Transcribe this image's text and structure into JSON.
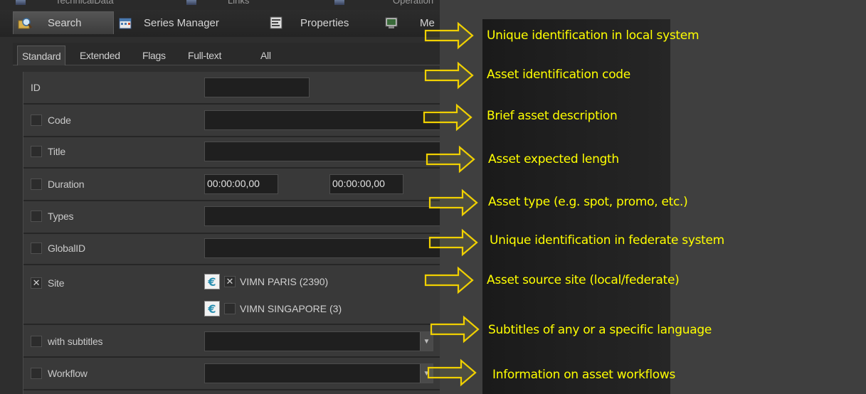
{
  "app": {
    "top_strip_ghost": [
      "TechnicalData",
      "Links",
      "Operation"
    ],
    "tabs": [
      {
        "label": "Search",
        "icon": "magnifier-folder-icon",
        "active": true
      },
      {
        "label": "Series Manager",
        "icon": "calendar-icon",
        "active": false
      },
      {
        "label": "Properties",
        "icon": "properties-icon",
        "active": false
      },
      {
        "label": "Me",
        "icon": "media-icon",
        "active": false
      }
    ],
    "subtabs": [
      "Standard",
      "Extended",
      "Flags",
      "Full-text",
      "All"
    ],
    "form": {
      "id_label": "ID",
      "id_value": "",
      "code_label": "Code",
      "title_label": "Title",
      "duration_label": "Duration",
      "duration_from": "00:00:00,00",
      "duration_to": "00:00:00,00",
      "types_label": "Types",
      "globalid_label": "GlobalID",
      "site_label": "Site",
      "site_checked": true,
      "sites": [
        {
          "label": "VIMN  PARIS  (2390)",
          "checked": true
        },
        {
          "label": "VIMN  SINGAPORE  (3)",
          "checked": false
        }
      ],
      "subtitles_label": "with subtitles",
      "workflow_label": "Workflow"
    }
  },
  "callouts": [
    "Unique identification in local system",
    "Asset identification code",
    "Brief asset description",
    "Asset expected length",
    "Asset type (e.g. spot, promo, etc.)",
    "Unique identification in federate system",
    "Asset source site (local/federate)",
    "Subtitles of any or a specific language",
    "Information on asset workflows"
  ],
  "colors": {
    "callout_text": "#ffff00",
    "arrow_fill": "#ffff55",
    "arrow_stroke": "#e0c000"
  }
}
